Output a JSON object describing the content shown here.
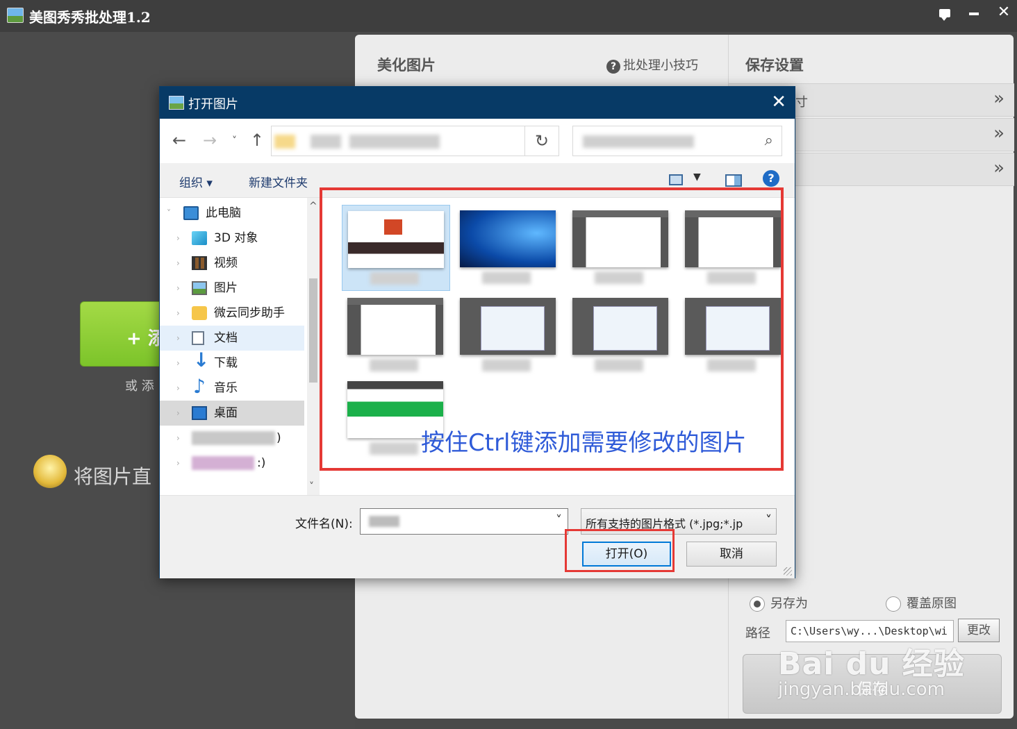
{
  "app": {
    "title": "美图秀秀批处理1.2",
    "add_button_label": "+ 添",
    "or_add_text": "或 添",
    "drag_hint_text": "将图片直",
    "middle_title": "美化图片",
    "tips_label": "批处理小技巧",
    "tips_icon": "?",
    "right_title": "保存设置",
    "accordion": [
      {
        "label": "寸",
        "chevron": "»"
      },
      {
        "label": "",
        "chevron": "»"
      },
      {
        "label": "",
        "chevron": "»"
      }
    ],
    "save_as_label": "另存为",
    "overwrite_label": "覆盖原图",
    "path_label": "路径",
    "path_value": "C:\\Users\\wy...\\Desktop\\wi",
    "change_label": "更改",
    "save_label": "保存"
  },
  "watermark": {
    "logo": "Bai du 经验",
    "url": "jingyan.baidu.com"
  },
  "dialog": {
    "title": "打开图片",
    "close_glyph": "✕",
    "nav": {
      "back": "←",
      "forward": "→",
      "recent": "˅",
      "up": "↑",
      "refresh": "↻",
      "dropdown": "˅",
      "search": "⌕"
    },
    "toolbar": {
      "organize": "组织 ▾",
      "new_folder": "新建文件夹",
      "help": "?"
    },
    "tree": [
      {
        "label": "此电脑",
        "icon": "pc-icon"
      },
      {
        "label": "3D 对象",
        "icon": "cube-icon"
      },
      {
        "label": "视频",
        "icon": "film-icon"
      },
      {
        "label": "图片",
        "icon": "picture-icon"
      },
      {
        "label": "微云同步助手",
        "icon": "cloud-icon"
      },
      {
        "label": "文档",
        "icon": "document-icon"
      },
      {
        "label": "下载",
        "icon": "download-icon"
      },
      {
        "label": "音乐",
        "icon": "music-icon"
      },
      {
        "label": "桌面",
        "icon": "desktop-icon"
      },
      {
        "label": ")",
        "icon": "drive-icon"
      },
      {
        "label": ":)",
        "icon": "drive-icon"
      }
    ],
    "annotation_text": "按住Ctrl键添加需要修改的图片",
    "filename_label": "文件名(N):",
    "filetype_value": "所有支持的图片格式 (*.jpg;*.jp",
    "open_label": "打开(O)",
    "cancel_label": "取消"
  },
  "colors": {
    "annotation_red": "#e53935",
    "annotation_blue": "#2f5bd8",
    "dialog_title": "#073a66",
    "add_green": "#7cc42a"
  }
}
